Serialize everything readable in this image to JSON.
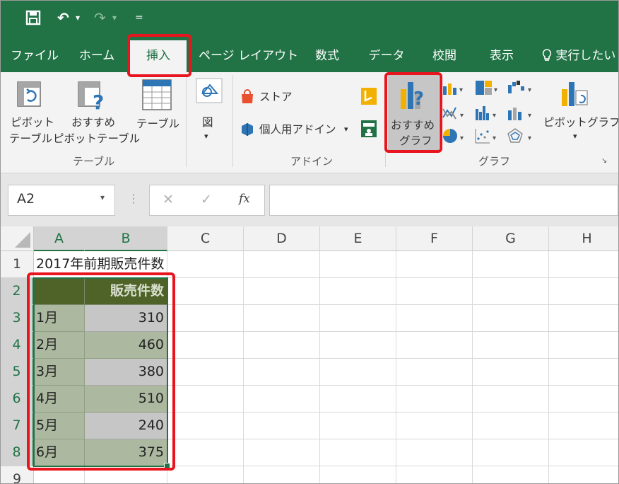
{
  "quick_access": {
    "save_icon": "save-icon",
    "undo": "↶",
    "undo_drop": "▾",
    "redo": "↷",
    "redo_drop": "▾",
    "customize": "="
  },
  "tabs": [
    {
      "label": "ファイル"
    },
    {
      "label": "ホーム"
    },
    {
      "label": "挿入",
      "active": true
    },
    {
      "label": "ページ レイアウト"
    },
    {
      "label": "数式"
    },
    {
      "label": "データ"
    },
    {
      "label": "校閲"
    },
    {
      "label": "表示"
    },
    {
      "label": "実行したい"
    }
  ],
  "ribbon": {
    "pivot_table": {
      "line1": "ピボット",
      "line2": "テーブル"
    },
    "recommended_pivot": {
      "line1": "おすすめ",
      "line2": "ピボットテーブル"
    },
    "table": {
      "label": "テーブル"
    },
    "group_table": "テーブル",
    "illustrations": {
      "label": "図",
      "drop": "▾"
    },
    "store": {
      "label": "ストア"
    },
    "my_addins": {
      "label": "個人用アドイン",
      "drop": "▾"
    },
    "group_addins": "アドイン",
    "recommended_chart": {
      "line1": "おすすめ",
      "line2": "グラフ"
    },
    "pivot_chart": {
      "label": "ピボットグラフ",
      "drop": "▾"
    },
    "group_chart": "グラフ",
    "launcher": "↘"
  },
  "formula_bar": {
    "name_box": "A2",
    "drop": "▾",
    "dots": "⋮",
    "cancel": "✕",
    "enter": "✓",
    "fx": "fx",
    "formula": ""
  },
  "columns": [
    "A",
    "B",
    "C",
    "D",
    "E",
    "F",
    "G",
    "H"
  ],
  "rows": [
    "1",
    "2",
    "3",
    "4",
    "5",
    "6",
    "7",
    "8",
    "9"
  ],
  "sheet": {
    "a1": "2017年前期販売件数",
    "header_b": "販売件数",
    "data": [
      {
        "month": "1月",
        "value": "310"
      },
      {
        "month": "2月",
        "value": "460"
      },
      {
        "month": "3月",
        "value": "380"
      },
      {
        "month": "4月",
        "value": "510"
      },
      {
        "month": "5月",
        "value": "240"
      },
      {
        "month": "6月",
        "value": "375"
      }
    ]
  },
  "colors": {
    "excel_green": "#217346",
    "highlight_red": "#e8141e",
    "header_fill": "#4f6228",
    "data_fill_a": "#acb9a0",
    "data_fill_b": "#c6c6c6"
  }
}
